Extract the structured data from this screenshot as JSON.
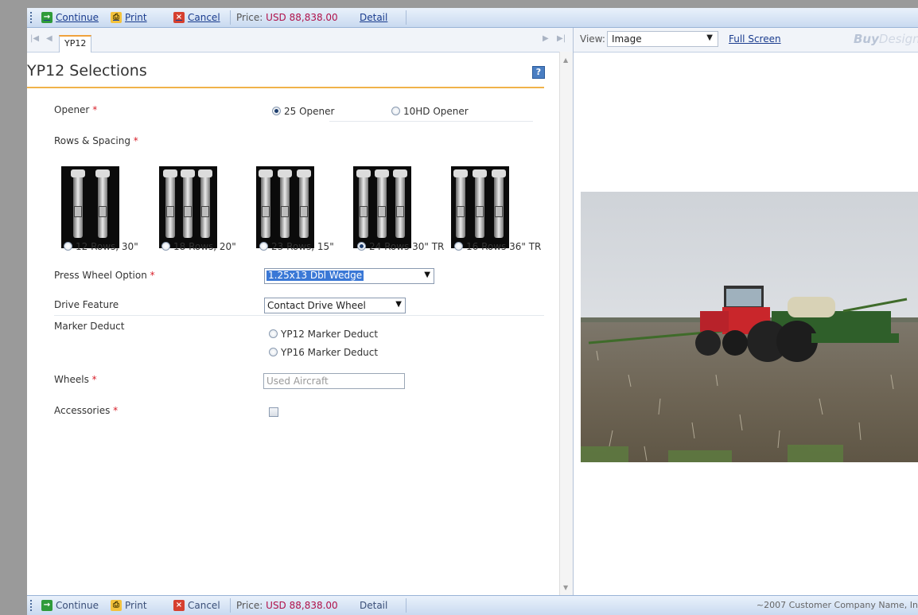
{
  "toolbar": {
    "continue": "Continue",
    "print": "Print",
    "cancel": "Cancel",
    "price_label": "Price:",
    "price_value": "USD 88,838.00",
    "detail": "Detail"
  },
  "footer": {
    "copyright": "~2007 Customer Company Name, In"
  },
  "tab": {
    "label": "YP12"
  },
  "selections": {
    "title": "YP12 Selections",
    "help": "?",
    "required_mark": "*",
    "opener": {
      "label": "Opener",
      "options": [
        "25 Opener",
        "10HD Opener"
      ],
      "selected": "25 Opener"
    },
    "rows_spacing": {
      "label": "Rows & Spacing",
      "options": [
        "12 Rows, 30\"",
        "18 Rows, 20\"",
        "23 Rows, 15\"",
        "24 Rows 30\" TR",
        "16 Rows 36\" TR"
      ],
      "selected": "24 Rows 30\" TR"
    },
    "press_wheel": {
      "label": "Press Wheel Option",
      "value": "1.25x13 Dbl Wedge"
    },
    "drive_feature": {
      "label": "Drive Feature",
      "value": "Contact Drive Wheel"
    },
    "marker_deduct": {
      "label": "Marker Deduct",
      "options": [
        "YP12 Marker Deduct",
        "YP16 Marker Deduct"
      ]
    },
    "wheels": {
      "label": "Wheels",
      "value": "Used Aircraft"
    },
    "accessories": {
      "label": "Accessories",
      "checked": false
    }
  },
  "viewer": {
    "view_label": "View:",
    "view_value": "Image",
    "full_screen": "Full Screen",
    "logo_buy": "Buy",
    "logo_design": "Design"
  },
  "icons": {
    "continue": "arrow-right-icon",
    "print": "printer-icon",
    "cancel": "x-icon",
    "help": "question-icon"
  }
}
